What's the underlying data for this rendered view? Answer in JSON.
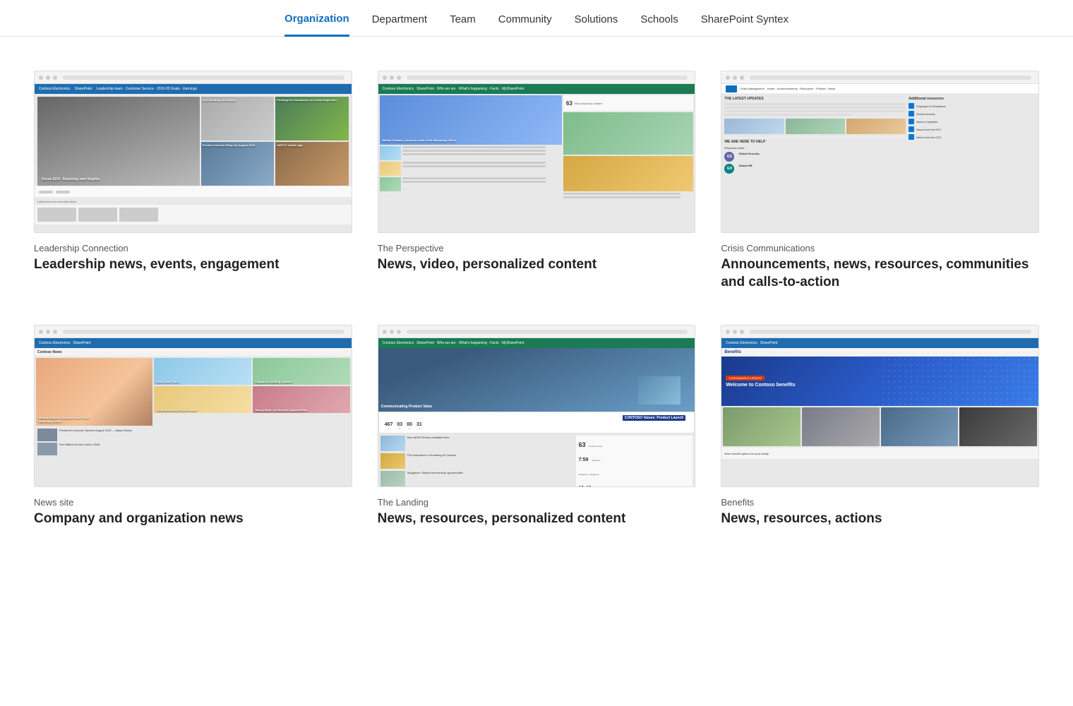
{
  "nav": {
    "items": [
      {
        "label": "Organization",
        "active": true
      },
      {
        "label": "Department",
        "active": false
      },
      {
        "label": "Team",
        "active": false
      },
      {
        "label": "Community",
        "active": false
      },
      {
        "label": "Solutions",
        "active": false
      },
      {
        "label": "Schools",
        "active": false
      },
      {
        "label": "SharePoint Syntex",
        "active": false
      }
    ]
  },
  "cards": [
    {
      "id": "leadership-connection",
      "category": "Leadership Connection",
      "title": "Leadership news, events, engagement"
    },
    {
      "id": "the-perspective",
      "category": "The Perspective",
      "title": "News, video, personalized content"
    },
    {
      "id": "crisis-communications",
      "category": "Crisis Communications",
      "title": "Announcements, news, resources, communities and calls-to-action"
    },
    {
      "id": "news-site",
      "category": "News site",
      "title": "Company and organization news"
    },
    {
      "id": "the-landing",
      "category": "The Landing",
      "title": "News, resources, personalized content"
    },
    {
      "id": "benefits",
      "category": "Benefits",
      "title": "News, resources, actions"
    }
  ],
  "avatars": [
    {
      "initials": "GS",
      "color": "#6264a7"
    },
    {
      "initials": "GH",
      "color": "#038387"
    }
  ],
  "countdown": {
    "days": "467",
    "hours": "03",
    "minutes": "00",
    "seconds": "31"
  }
}
